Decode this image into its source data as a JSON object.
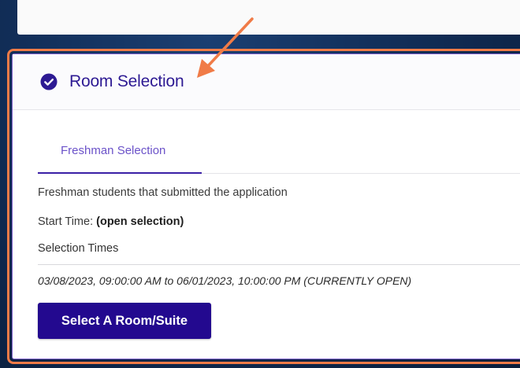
{
  "section": {
    "title": "Room Selection",
    "status_icon": "check-circle-icon"
  },
  "tabs": [
    {
      "label": "Freshman Selection",
      "active": true
    }
  ],
  "details": {
    "description": "Freshman students that submitted the application",
    "start_time_label": "Start Time:",
    "start_time_value": "(open selection)",
    "selection_times_heading": "Selection Times",
    "selection_range": "03/08/2023, 09:00:00 AM to 06/01/2023, 10:00:00 PM (CURRENTLY OPEN)"
  },
  "actions": {
    "select_label": "Select A Room/Suite"
  },
  "colors": {
    "accent": "#23098f",
    "highlight": "#f07b47",
    "tab_text": "#6b52c9"
  }
}
